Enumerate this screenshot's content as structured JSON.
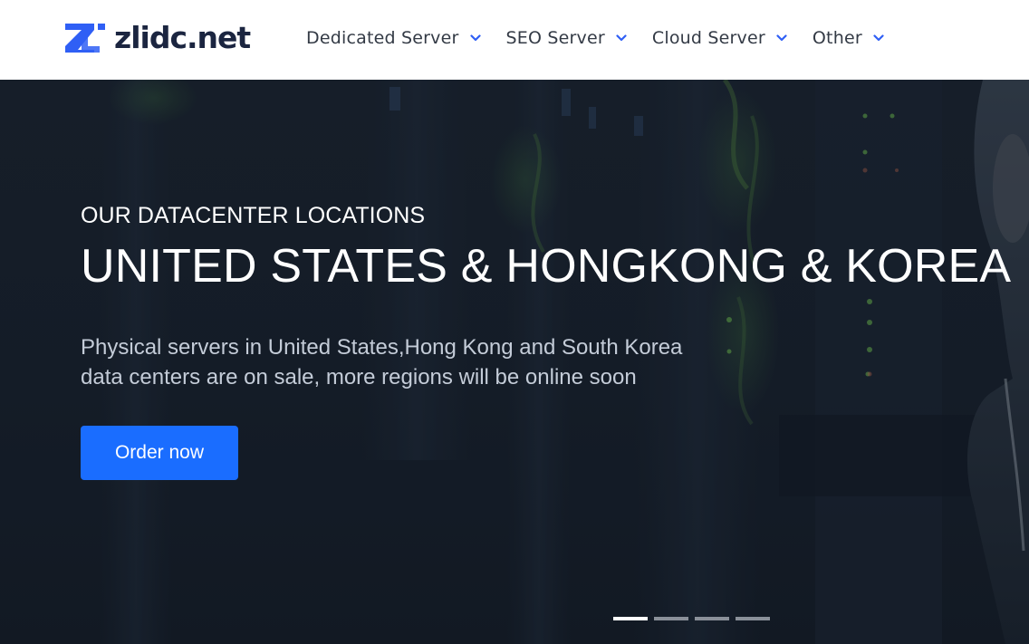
{
  "brand": {
    "name": "zlidc.net",
    "accent": "#2f5ff5"
  },
  "nav": {
    "items": [
      {
        "label": "Dedicated Server"
      },
      {
        "label": "SEO Server"
      },
      {
        "label": "Cloud Server"
      },
      {
        "label": "Other"
      }
    ],
    "chevron_icon": "chevron-down-icon"
  },
  "hero": {
    "eyebrow": "OUR DATACENTER LOCATIONS",
    "headline": "UNITED STATES & HONGKONG & KOREA",
    "description_line1": "Physical servers in United States,Hong Kong and South Korea",
    "description_line2": "data centers are on sale, more regions will be online soon",
    "cta_label": "Order now",
    "cta_color": "#1a6dff"
  },
  "carousel": {
    "slide_count": 4,
    "active_index": 0
  }
}
